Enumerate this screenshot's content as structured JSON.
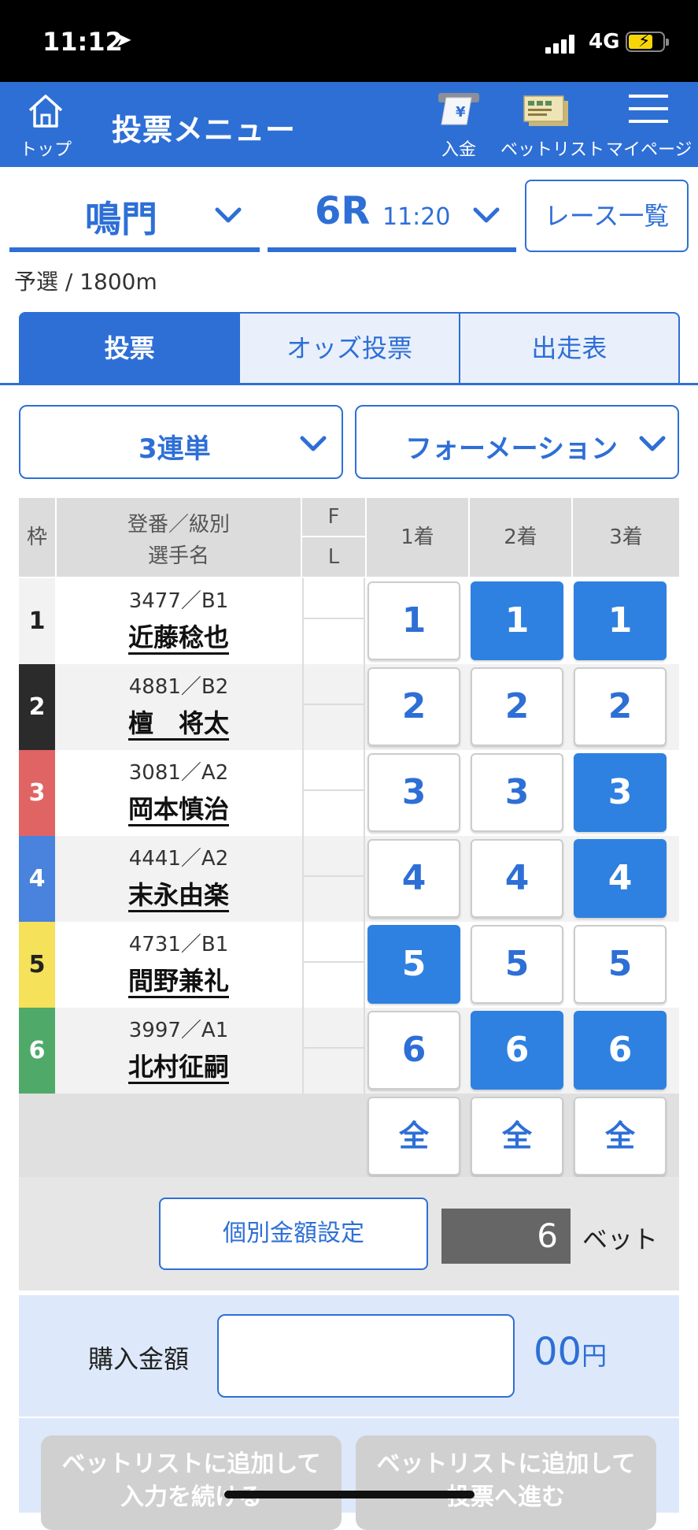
{
  "status": {
    "time": "11:12",
    "network": "4G"
  },
  "header": {
    "top_label": "トップ",
    "title": "投票メニュー",
    "deposit_label": "入金",
    "betlist_label": "ベットリスト",
    "mypage_label": "マイページ"
  },
  "race": {
    "venue": "鳴門",
    "race_no": "6R",
    "time": "11:20",
    "race_list_label": "レース一覧",
    "info": "予選 / 1800m"
  },
  "tabs": [
    "投票",
    "オッズ投票",
    "出走表"
  ],
  "bet_type": "3連単",
  "bet_method": "フォーメーション",
  "grid": {
    "header_frame": "枠",
    "header_racer_line1": "登番／級別",
    "header_racer_line2": "選手名",
    "header_f": "F",
    "header_l": "L",
    "header_places": [
      "1着",
      "2着",
      "3着"
    ],
    "all_label": "全",
    "rows": [
      {
        "frame": "1",
        "reg": "3477／B1",
        "name": "近藤稔也",
        "frame_color": "#f2f2f2",
        "frame_text": "#222",
        "sel": [
          false,
          true,
          true
        ]
      },
      {
        "frame": "2",
        "reg": "4881／B2",
        "name": "檀　将太",
        "frame_color": "#2b2b2b",
        "frame_text": "#fff",
        "sel": [
          false,
          false,
          false
        ]
      },
      {
        "frame": "3",
        "reg": "3081／A2",
        "name": "岡本慎治",
        "frame_color": "#e06464",
        "frame_text": "#fff",
        "sel": [
          false,
          false,
          true
        ]
      },
      {
        "frame": "4",
        "reg": "4441／A2",
        "name": "末永由楽",
        "frame_color": "#4a83dd",
        "frame_text": "#fff",
        "sel": [
          false,
          false,
          true
        ]
      },
      {
        "frame": "5",
        "reg": "4731／B1",
        "name": "間野兼礼",
        "frame_color": "#f5e15a",
        "frame_text": "#222",
        "sel": [
          true,
          false,
          false
        ]
      },
      {
        "frame": "6",
        "reg": "3997／A1",
        "name": "北村征嗣",
        "frame_color": "#4faa6a",
        "frame_text": "#fff",
        "sel": [
          false,
          true,
          true
        ]
      }
    ]
  },
  "bet": {
    "individual_label": "個別金額設定",
    "count": "6",
    "unit": "ベット"
  },
  "amount": {
    "label": "購入金額",
    "suffix_value": "00",
    "suffix_unit": "円"
  },
  "actions": {
    "continue_line1": "ベットリストに追加して",
    "continue_line2": "入力を続ける",
    "proceed_line1": "ベットリストに追加して",
    "proceed_line2": "投票へ進む"
  }
}
